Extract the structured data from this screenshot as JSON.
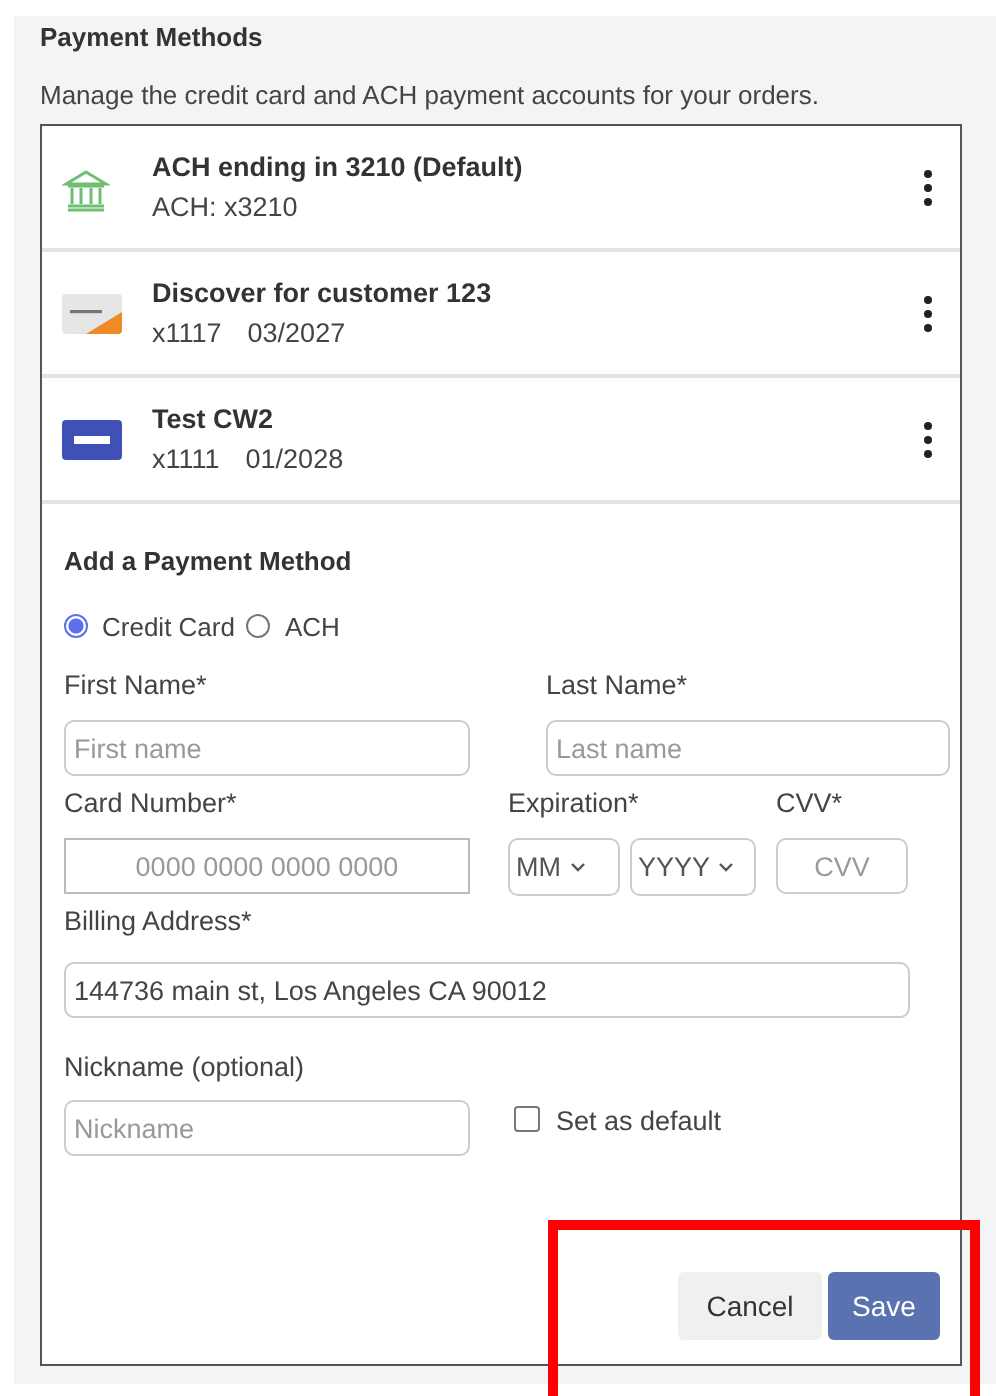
{
  "section": {
    "title": "Payment Methods",
    "description": "Manage the credit card and ACH payment accounts for your orders."
  },
  "methods": [
    {
      "kind": "bank",
      "title": "ACH ending in 3210 (Default)",
      "details": [
        "ACH: x3210"
      ]
    },
    {
      "kind": "discover",
      "title": "Discover for customer 123",
      "details": [
        "x1117",
        "03/2027"
      ]
    },
    {
      "kind": "visa",
      "title": "Test CW2",
      "details": [
        "x1111",
        "01/2028"
      ]
    }
  ],
  "form": {
    "title": "Add a Payment Method",
    "payment_types": [
      {
        "label": "Credit Card",
        "selected": true
      },
      {
        "label": "ACH",
        "selected": false
      }
    ],
    "first_name": {
      "label": "First Name*",
      "placeholder": "First name"
    },
    "last_name": {
      "label": "Last Name*",
      "placeholder": "Last name"
    },
    "card_number": {
      "label": "Card Number*",
      "placeholder": "0000 0000 0000 0000"
    },
    "expiration": {
      "label": "Expiration*",
      "month": "MM",
      "year": "YYYY"
    },
    "cvv": {
      "label": "CVV*",
      "placeholder": "CVV"
    },
    "billing_address": {
      "label": "Billing Address*",
      "value": "144736 main st, Los Angeles CA 90012"
    },
    "nickname": {
      "label": "Nickname (optional)",
      "placeholder": "Nickname"
    },
    "set_default": {
      "label": "Set as default",
      "checked": false
    },
    "buttons": [
      {
        "kind": "secondary",
        "label": "Cancel"
      },
      {
        "kind": "primary",
        "label": "Save"
      }
    ]
  }
}
